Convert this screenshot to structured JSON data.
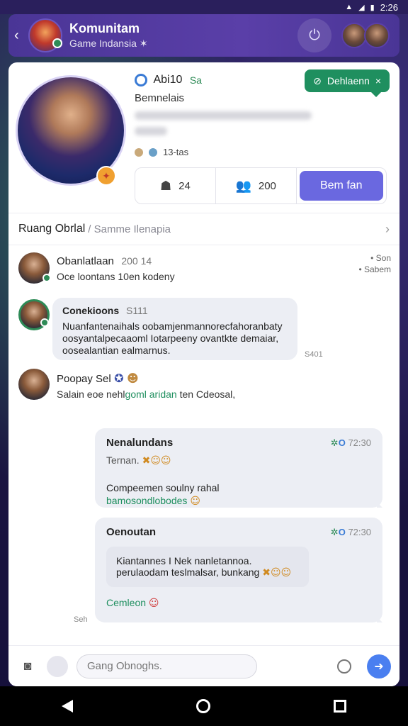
{
  "status_bar": {
    "time": "2:26"
  },
  "header": {
    "title": "Komunitam",
    "subtitle": "Game Indansia ✶",
    "back_label": "‹"
  },
  "profile": {
    "name": "Abi10",
    "tag": "Sa",
    "role": "Bemnelais",
    "meta": "13-tas",
    "join_chip": "Dehlaenn",
    "stats": [
      {
        "value": "24"
      },
      {
        "value": "200"
      }
    ],
    "follow_label": "Bem fan"
  },
  "room": {
    "title": "Ruang Obrlal",
    "subtitle": "/ Samme Ilenapia"
  },
  "messages": [
    {
      "name": "Obanlatlaan",
      "time": "200 14",
      "text": "Oce loontans 10en kodeny",
      "side1": "• Son",
      "side2": "• Sabem"
    },
    {
      "name": "Conekioons",
      "time": "S111",
      "body": "Nuanfantenaihals oobamjenmannorecfahoranbaty oosyantalpecaaoml Iotarpeeny ovantkte demaiar, oosealantian ealmarnus.",
      "stamp": "S401"
    },
    {
      "name": "Poopay Sel",
      "text_a": "Salain eoe nehl",
      "text_green": "goml aridan",
      "text_b": "ten Cdeosal,"
    }
  ],
  "right_bubbles": [
    {
      "title": "Nenalundans",
      "stamp": "72:30",
      "line1": "Ternan.",
      "line1_emoji": "✖☺☺",
      "line2": "Compeemen soulny rahal",
      "line3": "bamosondlobodes",
      "line3_emoji": "☺"
    },
    {
      "title": "Oenoutan",
      "stamp": "72:30",
      "quote": "Kiantannes I Nek nanletannoa. perulaodam teslmalsar, bunkang",
      "quote_emoji": "✖☺☺",
      "footer": "Cemleon",
      "footer_emoji": "☺",
      "side_time": "Seh"
    }
  ],
  "composer": {
    "placeholder": "Gang Obnoghs."
  },
  "colors": {
    "accent": "#6a68e0",
    "green": "#1f8f5f",
    "header": "#4a3596"
  }
}
